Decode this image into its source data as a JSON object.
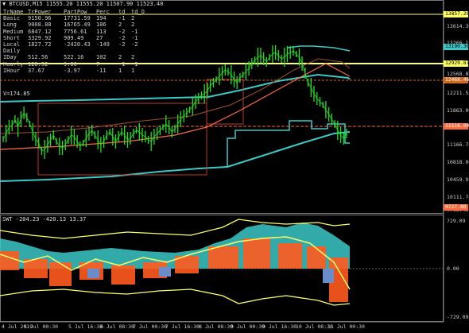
{
  "header": {
    "symbol_line": "BTCUSD,M15  11555.20 11555.20 11507.90 11523.40",
    "menu_icon": "triangle-down-icon"
  },
  "stats": {
    "columns": [
      "TrName",
      "TrPower",
      "PartPow",
      "Perc",
      "td",
      "td_O"
    ],
    "rows": [
      [
        "Basic",
        "9150.96",
        "17731.59",
        "194",
        "-1",
        "2"
      ],
      [
        "Long",
        "9008.88",
        "16765.49",
        "186",
        "2",
        "2"
      ],
      [
        "Medium",
        "6847.12",
        "7756.61",
        "113",
        "-2",
        "-1"
      ],
      [
        "Short",
        "3329.92",
        "909.49",
        "27",
        "-2",
        "-1"
      ],
      [
        "Local",
        "1827.72",
        "-2420.43",
        "-149",
        "-2",
        "-2"
      ],
      [
        "Daily",
        "",
        "",
        "",
        "",
        ""
      ],
      [
        "IDay",
        "512.56",
        "522.16",
        "102",
        "2",
        "2"
      ],
      [
        "Hourly",
        "128.52",
        "9.60",
        "7",
        "-1",
        "-1"
      ],
      [
        "IHour",
        "37.67",
        "-3.97",
        "-11",
        "1",
        "1"
      ]
    ],
    "v_label": "V=174.85"
  },
  "price_axis": {
    "ticks": [
      "13614.30",
      "13266.15",
      "12568.88",
      "12211.55",
      "11863.00",
      "11516.25",
      "11166.70",
      "10818.00",
      "10459.95",
      "10111.70",
      "9763.45"
    ],
    "tags": [
      {
        "text": "13857.20",
        "bg": "#ffff66",
        "fg": "#000000"
      },
      {
        "text": "13190.30",
        "bg": "#3cc8c8",
        "fg": "#000000"
      },
      {
        "text": "12929.87",
        "bg": "#ffff66",
        "fg": "#000000"
      },
      {
        "text": "12468.46",
        "bg": "#d2691e",
        "fg": "#ffffff"
      },
      {
        "text": "11516.90",
        "bg": "#ff6a3d",
        "fg": "#ffffff"
      },
      {
        "text": "9727.80",
        "bg": "#ff6a3d",
        "fg": "#ffffff"
      }
    ]
  },
  "oscillator": {
    "header": "SWT -204.23 -420.13 13.37",
    "ticks": [
      "729.09",
      "0.00",
      "-729.09"
    ]
  },
  "time_axis": {
    "ticks": [
      "4 Jul 2019",
      "5 Jul 00:30",
      "5 Jul 16:30",
      "6 Jul 08:30",
      "7 Jul 00:30",
      "7 Jul 16:30",
      "8 Jul 08:30",
      "9 Jul 00:30",
      "9 Jul 16:30",
      "10 Jul 08:30",
      "11 Jul 00:30"
    ]
  },
  "colors": {
    "candles": "#22e022",
    "cyan": "#3cc8c8",
    "yellow": "#ffff66",
    "orange": "#ff6a3d",
    "brown": "#d2691e",
    "osc_fill": "#3cc8c8",
    "osc_hist": "#ff5a1f"
  }
}
